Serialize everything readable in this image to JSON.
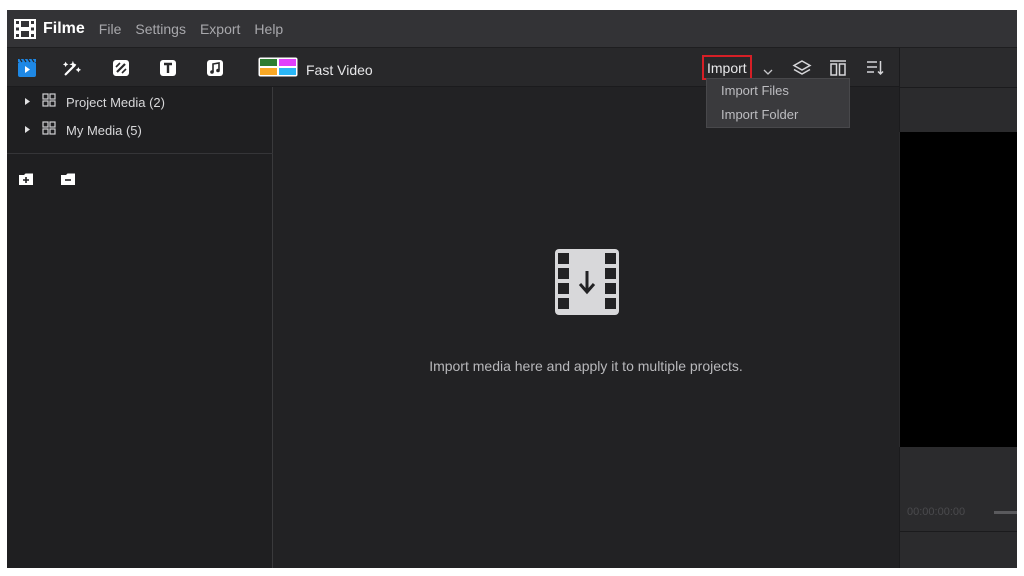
{
  "app": {
    "name": "Filme",
    "menu": [
      "File",
      "Settings",
      "Export",
      "Help"
    ]
  },
  "toolbar": {
    "tools": [
      "media-icon",
      "effects-icon",
      "transitions-icon",
      "text-icon",
      "audio-icon"
    ],
    "fast_video_label": "Fast Video",
    "import_label": "Import",
    "right_icons": [
      "layers-icon",
      "split-view-icon",
      "sort-icon"
    ]
  },
  "import_dropdown": {
    "items": [
      "Import Files",
      "Import Folder"
    ]
  },
  "media_tree": {
    "items": [
      {
        "label": "Project Media (2)"
      },
      {
        "label": "My Media (5)"
      }
    ],
    "actions": [
      "add-folder-icon",
      "remove-folder-icon"
    ]
  },
  "media_area": {
    "empty_message": "Import media here and apply it to multiple projects."
  },
  "preview": {
    "timecode": "00:00:00:00"
  },
  "colors": {
    "accent_blue": "#1e88e5",
    "import_highlight": "#d61f26"
  }
}
